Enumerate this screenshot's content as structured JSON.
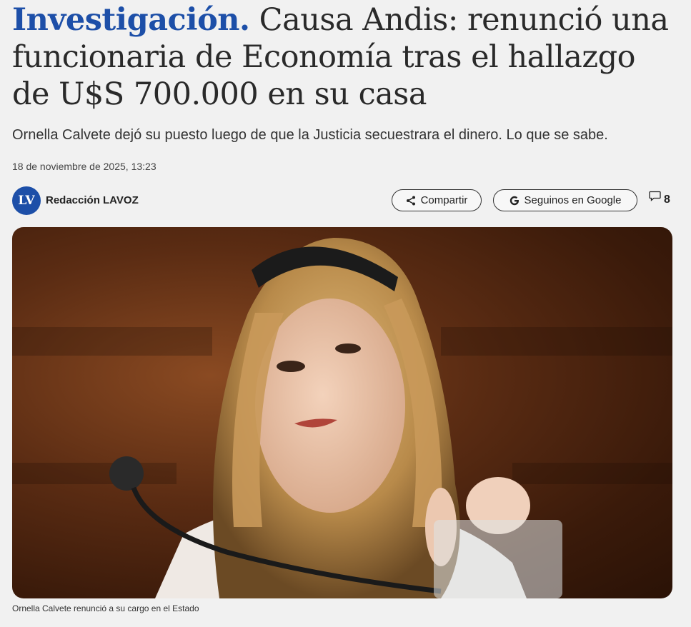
{
  "article": {
    "kicker": "Investigación.",
    "headline": "Causa Andis: renunció una funcionaria de Economía tras el hallazgo de U$S 700.000 en su casa",
    "subtitle": "Ornella Calvete dejó su puesto luego de que la Justicia secuestrara el dinero. Lo que se sabe.",
    "date": "18 de noviembre de 2025, 13:23"
  },
  "author": {
    "avatar_initials": "LV",
    "name": "Redacción LAVOZ",
    "avatar_color": "#1d4fa8"
  },
  "actions": {
    "share_label": "Compartir",
    "share_icon": "share-icon",
    "google_label": "Seguinos en Google",
    "google_icon": "google-g-icon",
    "comments_icon": "comment-icon",
    "comments_count": "8"
  },
  "photo": {
    "caption": "Ornella Calvete renunció a su cargo en el Estado"
  },
  "colors": {
    "accent": "#1d4fa8",
    "background": "#f1f1f1",
    "text": "#2a2a2a"
  }
}
